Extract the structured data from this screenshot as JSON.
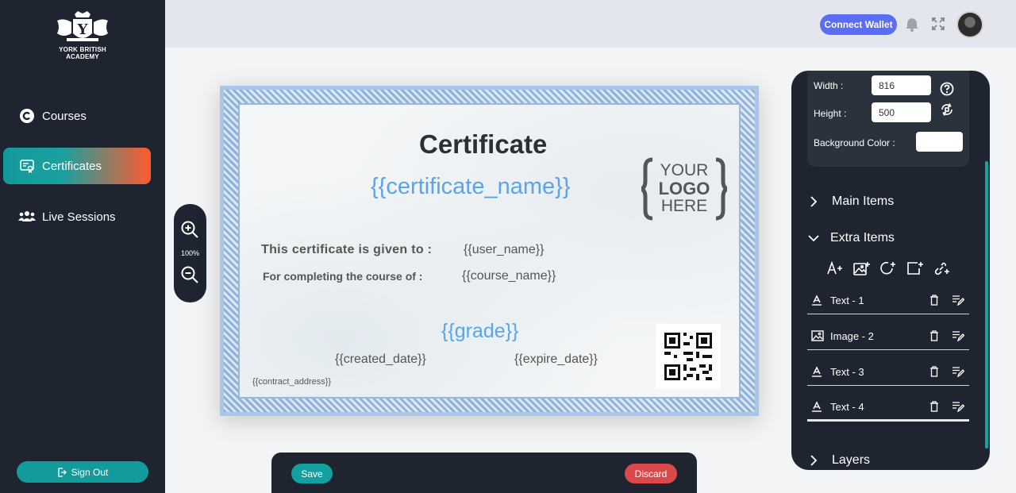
{
  "sidebar": {
    "logo_text_line1": "YORK BRITISH",
    "logo_text_line2": "ACADEMY",
    "nav": [
      {
        "label": "Courses",
        "icon": "copyright-icon"
      },
      {
        "label": "Certificates",
        "icon": "certificate-icon",
        "active": true
      },
      {
        "label": "Live Sessions",
        "icon": "group-icon"
      }
    ],
    "signout_label": "Sign Out"
  },
  "topbar": {
    "connect_wallet_label": "Connect Wallet"
  },
  "zoom": {
    "level": "100%"
  },
  "certificate": {
    "title": "Certificate",
    "name_placeholder": "{{certificate_name}}",
    "given_text": "This certificate is given to :",
    "user_placeholder": "{{user_name}}",
    "complete_text": "For completing the course of :",
    "course_placeholder": "{{course_name}}",
    "grade_placeholder": "{{grade}}",
    "created_placeholder": "{{created_date}}",
    "expire_placeholder": "{{expire_date}}",
    "contract_placeholder": "{{contract_address}}",
    "logo_line1": "YOUR",
    "logo_line2": "LOGO",
    "logo_line3": "HERE"
  },
  "panel": {
    "width_label": "Width :",
    "width_value": "816",
    "height_label": "Height :",
    "height_value": "500",
    "bg_label": "Background Color :",
    "bg_value": "#ffffff",
    "main_items_label": "Main Items",
    "extra_items_label": "Extra Items",
    "layers_label": "Layers",
    "items": [
      {
        "label": "Text - 1",
        "type": "text"
      },
      {
        "label": "Image - 2",
        "type": "image"
      },
      {
        "label": "Text - 3",
        "type": "text"
      },
      {
        "label": "Text - 4",
        "type": "text"
      }
    ]
  },
  "actions": {
    "save_label": "Save",
    "discard_label": "Discard"
  }
}
